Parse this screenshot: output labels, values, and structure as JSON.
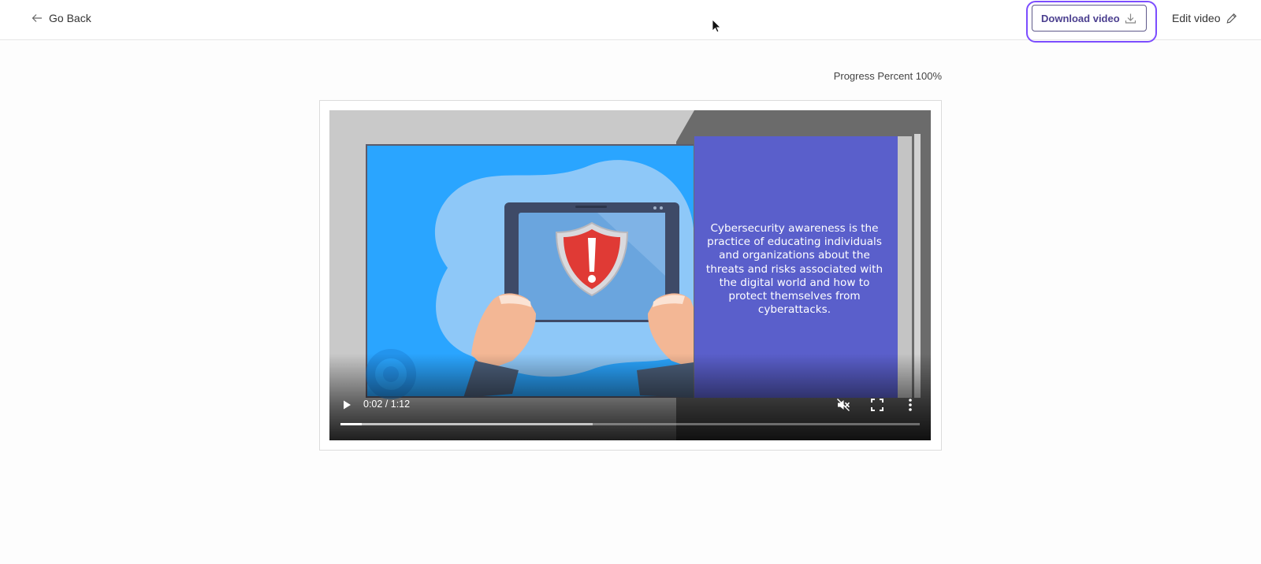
{
  "header": {
    "back_label": "Go Back",
    "download_label": "Download video",
    "edit_label": "Edit video"
  },
  "progress": {
    "label": "Progress Percent 100%",
    "percent": 100
  },
  "video": {
    "caption": "Cybersecurity awareness is the practice of educating individuals and organizations about the threats and risks associated with the digital world and how to protect themselves from cyberattacks.",
    "time_display": "0:02 / 1:12",
    "played_fraction": 0.037,
    "buffered_fraction": 0.436,
    "muted": true
  },
  "icons": {
    "back": "arrow-left-icon",
    "download": "download-icon",
    "edit": "pencil-icon",
    "play": "play-icon",
    "mute": "volume-muted-icon",
    "fullscreen": "fullscreen-icon",
    "more": "more-vertical-icon"
  },
  "colors": {
    "accent": "#7c4dff",
    "button_text": "#4b3f8f",
    "slide_panel": "#5a5fcb",
    "slide_background": "#29a3ff"
  }
}
